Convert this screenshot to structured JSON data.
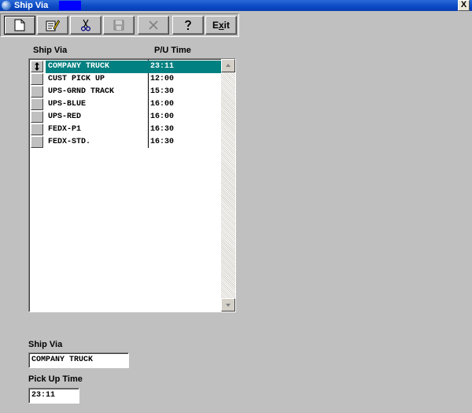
{
  "window": {
    "title": "Ship Via",
    "close_label": "X"
  },
  "toolbar": {
    "new_icon": "new-document-icon",
    "edit_icon": "edit-pencil-icon",
    "cut_icon": "scissors-icon",
    "save_icon": "floppy-disk-icon",
    "delete_icon": "delete-x-icon",
    "help_icon": "question-mark-icon",
    "exit_label": "Exit"
  },
  "grid": {
    "headers": {
      "ship_via": "Ship Via",
      "pu_time": "P/U Time"
    },
    "selected_row_color": "#008080",
    "rows": [
      {
        "ship_via": "COMPANY TRUCK",
        "pu_time": "23:11"
      },
      {
        "ship_via": "CUST PICK UP",
        "pu_time": "12:00"
      },
      {
        "ship_via": "UPS-GRND TRACK",
        "pu_time": "15:30"
      },
      {
        "ship_via": "UPS-BLUE",
        "pu_time": "16:00"
      },
      {
        "ship_via": "UPS-RED",
        "pu_time": "16:00"
      },
      {
        "ship_via": "FEDX-P1",
        "pu_time": "16:30"
      },
      {
        "ship_via": "FEDX-STD.",
        "pu_time": "16:30"
      }
    ]
  },
  "form": {
    "ship_via_label": "Ship Via",
    "ship_via_value": "COMPANY TRUCK",
    "pickup_label": "Pick Up Time",
    "pickup_value": "23:11"
  }
}
